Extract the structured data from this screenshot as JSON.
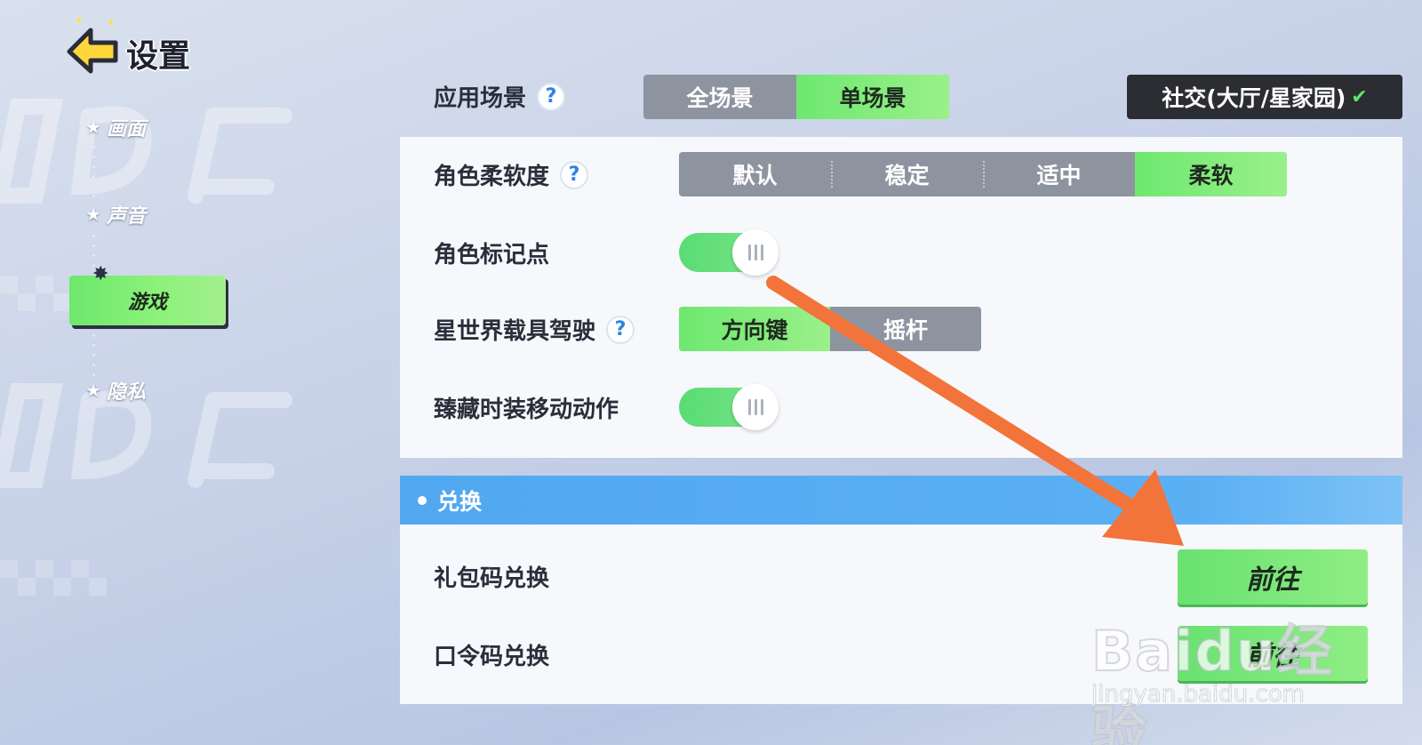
{
  "header": {
    "title": "设置"
  },
  "sidebar": {
    "items": [
      {
        "label": "画面"
      },
      {
        "label": "声音"
      },
      {
        "label": "游戏"
      },
      {
        "label": "隐私"
      }
    ]
  },
  "settings": {
    "scene": {
      "label": "应用场景",
      "options": [
        "全场景",
        "单场景"
      ],
      "selected": "单场景",
      "dropdown_value": "社交(大厅/星家园)"
    },
    "softness": {
      "label": "角色柔软度",
      "options": [
        "默认",
        "稳定",
        "适中",
        "柔软"
      ],
      "selected": "柔软"
    },
    "markers": {
      "label": "角色标记点",
      "enabled": true
    },
    "vehicle": {
      "label": "星世界载具驾驶",
      "options": [
        "方向键",
        "摇杆"
      ],
      "selected": "方向键"
    },
    "outfit_motion": {
      "label": "臻藏时装移动动作",
      "enabled": true
    }
  },
  "redeem": {
    "section_title": "兑换",
    "gift_code": {
      "label": "礼包码兑换",
      "button": "前往"
    },
    "password_code": {
      "label": "口令码兑换",
      "button": "前往"
    }
  },
  "watermark": {
    "logo": "Baidu经验",
    "url": "jingyan.baidu.com"
  },
  "colors": {
    "accent_green": "#6ee86f",
    "section_blue": "#52a8f0",
    "segment_gray": "#8d939f",
    "annotation_arrow": "#f2743a"
  }
}
